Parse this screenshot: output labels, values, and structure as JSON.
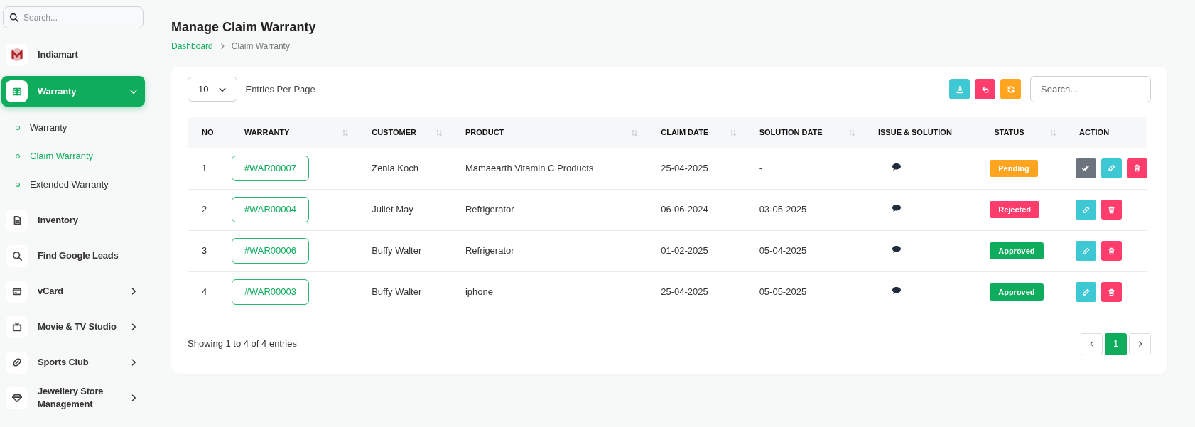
{
  "sidebar": {
    "search": {
      "placeholder": "Search..."
    },
    "items": [
      {
        "label": "Indiamart",
        "selected": false,
        "has_submenu": false
      },
      {
        "label": "Warranty",
        "selected": true,
        "has_submenu": true,
        "expanded": true,
        "children": [
          {
            "label": "Warranty",
            "selected": false
          },
          {
            "label": "Claim Warranty",
            "selected": true
          },
          {
            "label": "Extended Warranty",
            "selected": false
          }
        ]
      },
      {
        "label": "Inventory",
        "selected": false,
        "has_submenu": false
      },
      {
        "label": "Find Google Leads",
        "selected": false,
        "has_submenu": false
      },
      {
        "label": "vCard",
        "selected": false,
        "has_submenu": true,
        "expanded": false
      },
      {
        "label": "Movie & TV Studio",
        "selected": false,
        "has_submenu": true,
        "expanded": false
      },
      {
        "label": "Sports Club",
        "selected": false,
        "has_submenu": true,
        "expanded": false
      },
      {
        "label": "Jewellery Store Management",
        "selected": false,
        "has_submenu": true,
        "expanded": false
      }
    ]
  },
  "page": {
    "title": "Manage Claim Warranty",
    "breadcrumb": [
      "Dashboard",
      "Claim Warranty"
    ]
  },
  "toolbar": {
    "entries_value": "10",
    "entries_label": "Entries Per Page",
    "buttons": [
      {
        "kind": "download"
      },
      {
        "kind": "undo"
      },
      {
        "kind": "refresh"
      }
    ],
    "search": {
      "placeholder": "Search..."
    }
  },
  "table": {
    "columns": [
      {
        "label": "NO",
        "sortable": false
      },
      {
        "label": "WARRANTY",
        "sortable": true
      },
      {
        "label": "CUSTOMER",
        "sortable": true
      },
      {
        "label": "PRODUCT",
        "sortable": true
      },
      {
        "label": "CLAIM DATE",
        "sortable": true
      },
      {
        "label": "SOLUTION DATE",
        "sortable": true
      },
      {
        "label": "ISSUE & SOLUTION",
        "sortable": false
      },
      {
        "label": "STATUS",
        "sortable": true
      },
      {
        "label": "ACTION",
        "sortable": false
      }
    ],
    "rows": [
      {
        "no": "1",
        "warranty": "#WAR00007",
        "customer": "Zenia Koch",
        "product": "Mamaearth Vitamin C Products",
        "claim_date": "25-04-2025",
        "solution_date": "-",
        "status": {
          "label": "Pending",
          "kind": "pending"
        },
        "actions": [
          {
            "kind": "approve"
          },
          {
            "kind": "edit"
          },
          {
            "kind": "delete"
          }
        ]
      },
      {
        "no": "2",
        "warranty": "#WAR00004",
        "customer": "Juliet May",
        "product": "Refrigerator",
        "claim_date": "06-06-2024",
        "solution_date": "03-05-2025",
        "status": {
          "label": "Rejected",
          "kind": "rejected"
        },
        "actions": [
          {
            "kind": "edit"
          },
          {
            "kind": "delete"
          }
        ]
      },
      {
        "no": "3",
        "warranty": "#WAR00006",
        "customer": "Buffy Walter",
        "product": "Refrigerator",
        "claim_date": "01-02-2025",
        "solution_date": "05-04-2025",
        "status": {
          "label": "Approved",
          "kind": "approved"
        },
        "actions": [
          {
            "kind": "edit"
          },
          {
            "kind": "delete"
          }
        ]
      },
      {
        "no": "4",
        "warranty": "#WAR00003",
        "customer": "Buffy Walter",
        "product": "iphone",
        "claim_date": "25-04-2025",
        "solution_date": "05-05-2025",
        "status": {
          "label": "Approved",
          "kind": "approved"
        },
        "actions": [
          {
            "kind": "edit"
          },
          {
            "kind": "delete"
          }
        ]
      }
    ]
  },
  "footer": {
    "summary": "Showing 1 to 4 of 4 entries",
    "pages": [
      {
        "label": "1",
        "selected": true
      }
    ]
  }
}
